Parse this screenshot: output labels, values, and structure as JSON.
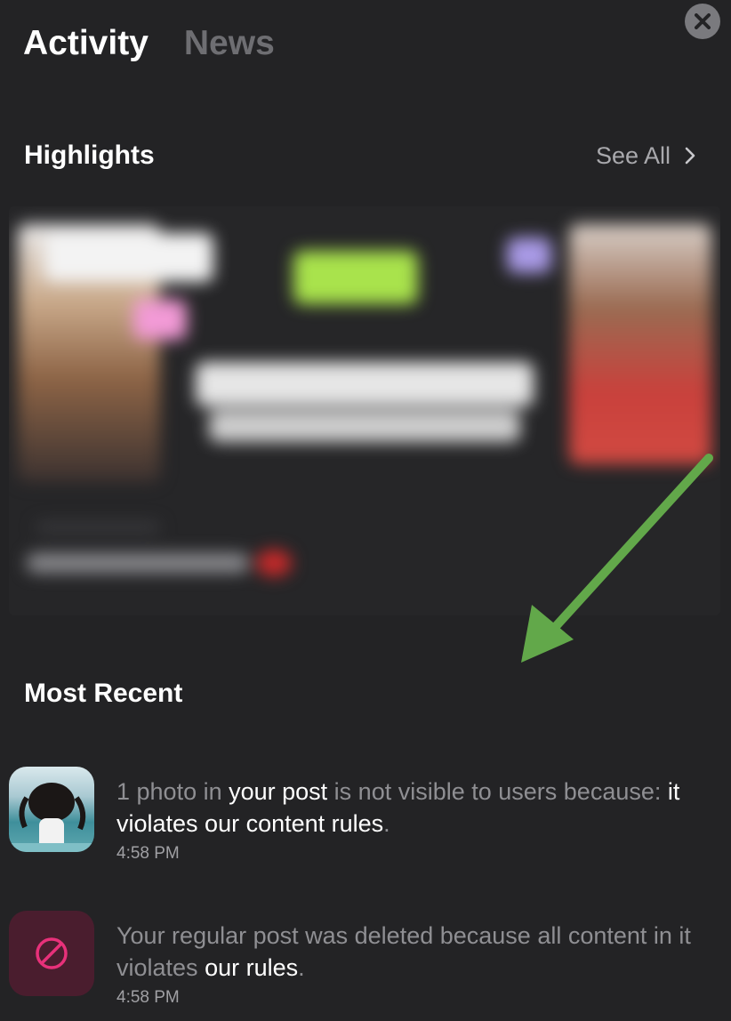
{
  "tabs": [
    {
      "label": "Activity",
      "active": true
    },
    {
      "label": "News",
      "active": false
    }
  ],
  "close_icon": "close-icon",
  "highlights": {
    "title": "Highlights",
    "see_all": "See All"
  },
  "most_recent": {
    "title": "Most Recent"
  },
  "notifications": [
    {
      "icon": "photo-thumbnail",
      "parts": [
        "1 photo in ",
        "your post",
        " is not visible to users because: ",
        "it violates our content rules",
        "."
      ],
      "time": "4:58 PM"
    },
    {
      "icon": "prohibited-icon",
      "parts": [
        "Your regular post was deleted because all content in it violates ",
        "our rules",
        "."
      ],
      "time": "4:58 PM"
    }
  ],
  "colors": {
    "background": "#232325",
    "muted_text": "#8f8f93",
    "accent_pink": "#e8317a",
    "arrow_green": "#62a84a"
  }
}
